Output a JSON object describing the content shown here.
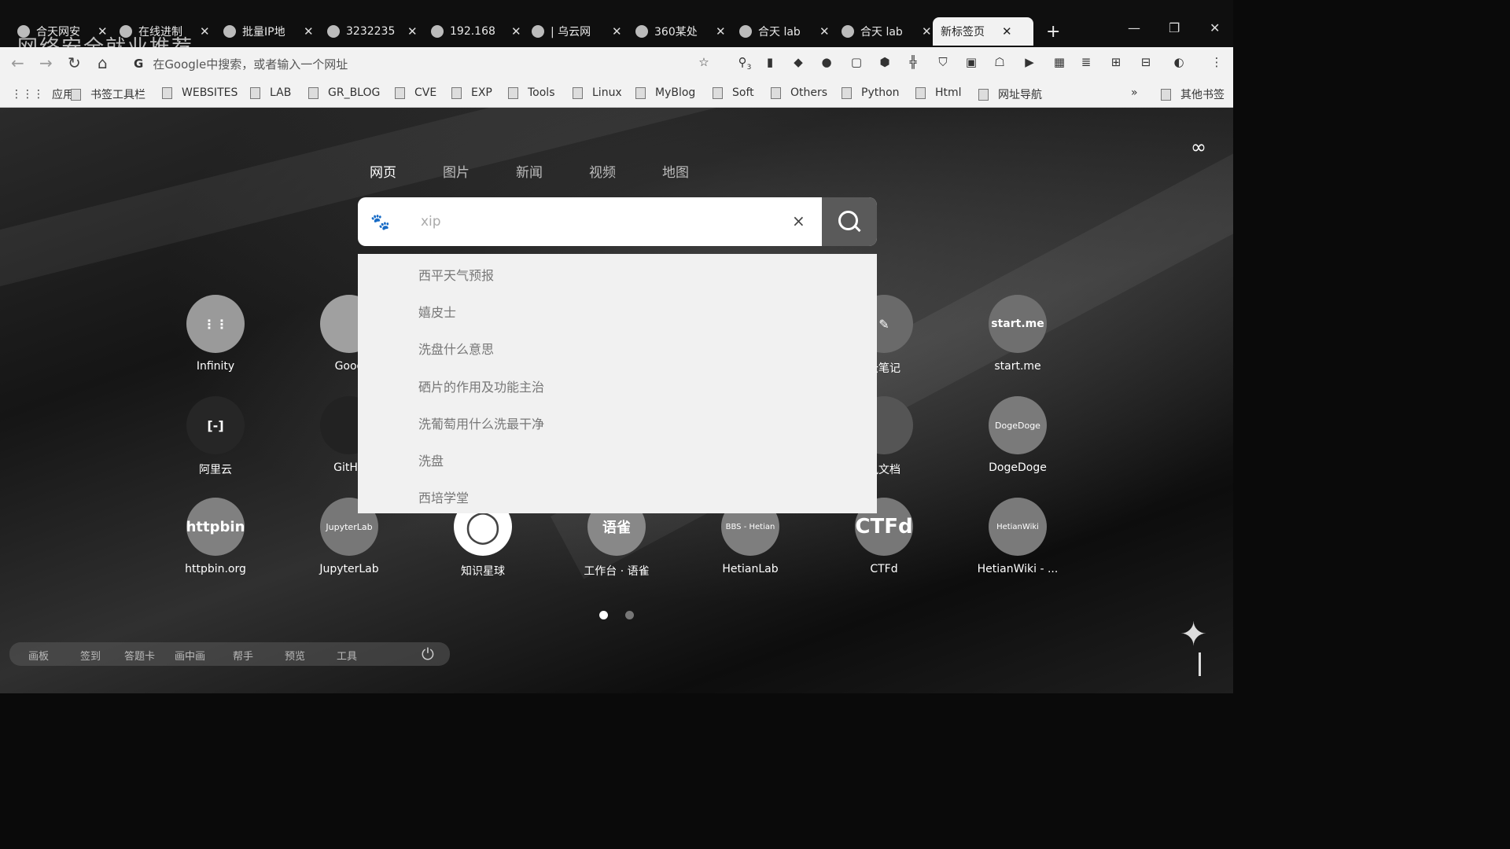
{
  "tabs": [
    {
      "title": "合天网安",
      "active": false
    },
    {
      "title": "在线进制",
      "active": false
    },
    {
      "title": "批量IP地",
      "active": false
    },
    {
      "title": "3232235",
      "active": false
    },
    {
      "title": "192.168",
      "active": false
    },
    {
      "title": "| 乌云网",
      "active": false
    },
    {
      "title": "360某处",
      "active": false
    },
    {
      "title": "合天 lab",
      "active": false
    },
    {
      "title": "合天 lab",
      "active": false
    },
    {
      "title": "新标签页",
      "active": true
    }
  ],
  "overlay_text": "网络安全就业推荐",
  "address": {
    "placeholder": "在Google中搜索，或者输入一个网址",
    "engine_icon": "G"
  },
  "extensions": {
    "badge": "3"
  },
  "bookmarks": [
    "应用",
    "书签工具栏",
    "WEBSITES",
    "LAB",
    "GR_BLOG",
    "CVE",
    "EXP",
    "Tools",
    "Linux",
    "MyBlog",
    "Soft",
    "Others",
    "Python",
    "Html",
    "网址导航"
  ],
  "bookmarks_more": "»",
  "other_bookmarks": "其他书签",
  "search_tabs": [
    "网页",
    "图片",
    "新闻",
    "视频",
    "地图"
  ],
  "search": {
    "value": "xip",
    "clear": "×"
  },
  "suggestions": [
    "西平天气预报",
    "嬉皮士",
    "洗盘什么意思",
    "硒片的作用及功能主治",
    "洗葡萄用什么洗最干净",
    "洗盘",
    "西培学堂"
  ],
  "tiles": [
    {
      "label": "Infinity",
      "icon": "⋮⋮"
    },
    {
      "label": "Goog",
      "icon": ""
    },
    {
      "label": "云笔记",
      "icon": "✎"
    },
    {
      "label": "start.me",
      "icon": "start.me"
    },
    {
      "label": "阿里云",
      "icon": "[-]"
    },
    {
      "label": "GitHu",
      "icon": ""
    },
    {
      "label": "讯文档",
      "icon": ""
    },
    {
      "label": "DogeDoge",
      "icon": "DogeDoge"
    },
    {
      "label": "httpbin.org",
      "icon": "httpbin"
    },
    {
      "label": "JupyterLab",
      "icon": "JupyterLab"
    },
    {
      "label": "知识星球",
      "icon": "◯"
    },
    {
      "label": "工作台 · 语雀",
      "icon": "语雀"
    },
    {
      "label": "HetianLab",
      "icon": "BBS - Hetian"
    },
    {
      "label": "CTFd",
      "icon": "CTFd"
    },
    {
      "label": "HetianWiki - ...",
      "icon": "HetianWiki"
    }
  ],
  "dock": [
    "画板",
    "签到",
    "答题卡",
    "画中画",
    "帮手",
    "预览",
    "工具"
  ],
  "infinity": "∞"
}
